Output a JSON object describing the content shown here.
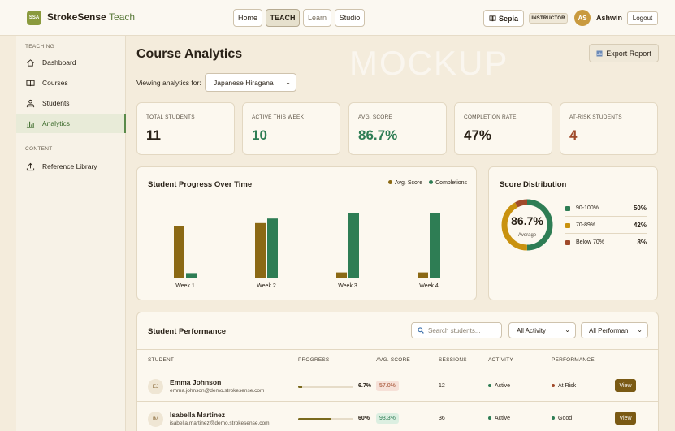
{
  "header": {
    "logo_badge": "SSA",
    "app_name": "StrokeSense",
    "app_suffix": "Teach",
    "nav": [
      "Home",
      "TEACH",
      "Learn",
      "Studio"
    ],
    "theme_label": "Sepia",
    "role": "INSTRUCTOR",
    "avatar_initials": "AS",
    "user_name": "Ashwin",
    "logout": "Logout"
  },
  "sidebar": {
    "section_teaching": "TEACHING",
    "section_content": "CONTENT",
    "items": [
      "Dashboard",
      "Courses",
      "Students",
      "Analytics",
      "Reference Library"
    ],
    "active": "Analytics"
  },
  "main": {
    "title": "Course Analytics",
    "watermark": "MOCKUP",
    "export_label": "Export Report",
    "viewing_label": "Viewing analytics for:",
    "course": "Japanese Hiragana"
  },
  "stats": [
    {
      "label": "TOTAL STUDENTS",
      "value": "11",
      "color": "#2a2218"
    },
    {
      "label": "ACTIVE THIS WEEK",
      "value": "10",
      "color": "#2e7d54"
    },
    {
      "label": "AVG. SCORE",
      "value": "86.7%",
      "color": "#2e7d54"
    },
    {
      "label": "COMPLETION RATE",
      "value": "47%",
      "color": "#2a2218"
    },
    {
      "label": "AT-RISK STUDENTS",
      "value": "4",
      "color": "#a04a2a"
    }
  ],
  "progress_chart": {
    "title": "Student Progress Over Time",
    "legend": [
      {
        "name": "Avg. Score",
        "color": "#8b6914"
      },
      {
        "name": "Completions",
        "color": "#2e7d54"
      }
    ]
  },
  "chart_data": {
    "type": "bar",
    "categories": [
      "Week 1",
      "Week 2",
      "Week 3",
      "Week 4"
    ],
    "series": [
      {
        "name": "Avg. Score",
        "values": [
          80,
          84,
          8,
          8
        ]
      },
      {
        "name": "Completions",
        "values": [
          7,
          91,
          100,
          100
        ]
      }
    ],
    "ylim": [
      0,
      100
    ]
  },
  "distribution": {
    "title": "Score Distribution",
    "center_value": "86.7%",
    "center_label": "Average",
    "rows": [
      {
        "label": "90-100%",
        "pct": "50%",
        "value": 50,
        "color": "#2e7d54"
      },
      {
        "label": "70-89%",
        "pct": "42%",
        "value": 42,
        "color": "#c9920f"
      },
      {
        "label": "Below 70%",
        "pct": "8%",
        "value": 8,
        "color": "#a04a2a"
      }
    ]
  },
  "performance": {
    "title": "Student Performance",
    "search_placeholder": "Search students...",
    "filter_activity": "All Activity",
    "filter_performance": "All Performan",
    "columns": [
      "STUDENT",
      "PROGRESS",
      "AVG. SCORE",
      "SESSIONS",
      "ACTIVITY",
      "PERFORMANCE"
    ],
    "rows": [
      {
        "initials": "EJ",
        "name": "Emma Johnson",
        "email": "emma.johnson@demo.strokesense.com",
        "progress": "6.7%",
        "progress_value": 6.7,
        "score": "57.0%",
        "score_bg": "#f6e1d8",
        "score_color": "#a04a2a",
        "sessions": "12",
        "activity": "Active",
        "activity_color": "#2e7d54",
        "performance": "At Risk",
        "performance_color": "#a04a2a",
        "action": "View"
      },
      {
        "initials": "IM",
        "name": "Isabella Martinez",
        "email": "isabella.martinez@demo.strokesense.com",
        "progress": "60%",
        "progress_value": 60,
        "score": "93.3%",
        "score_bg": "#dcefe1",
        "score_color": "#2e7d54",
        "sessions": "36",
        "activity": "Active",
        "activity_color": "#2e7d54",
        "performance": "Good",
        "performance_color": "#2e7d54",
        "action": "View"
      }
    ]
  }
}
